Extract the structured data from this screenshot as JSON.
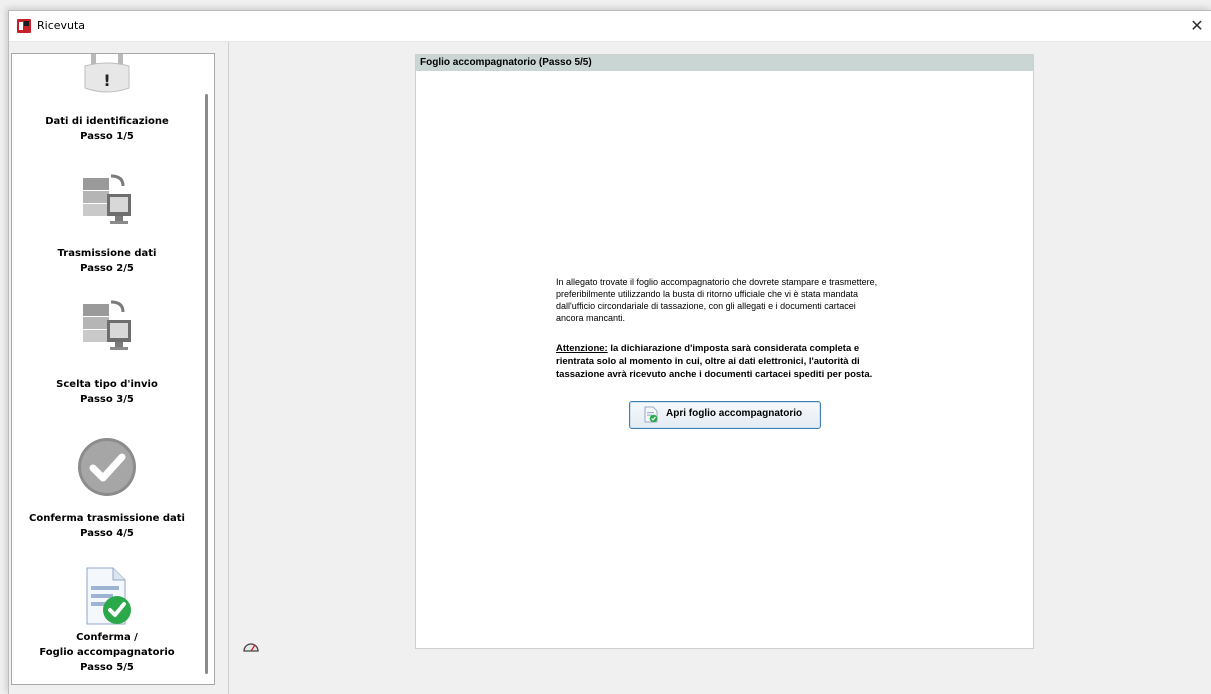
{
  "window": {
    "title": "Ricevuta",
    "close_glyph": "✕"
  },
  "steps": [
    {
      "icon": "lock-warning-icon",
      "name": "Dati di identificazione",
      "step": "Passo 1/5"
    },
    {
      "icon": "server-transfer-icon",
      "name": "Trasmissione dati",
      "step": "Passo 2/5"
    },
    {
      "icon": "server-transfer-icon",
      "name": "Scelta tipo d'invio",
      "step": "Passo 3/5"
    },
    {
      "icon": "checkmark-circle-icon",
      "name": "Conferma trasmissione dati",
      "step": "Passo 4/5"
    },
    {
      "icon": "document-check-icon",
      "name": "Conferma /",
      "name2": "Foglio accompagnatorio",
      "step": "Passo 5/5"
    }
  ],
  "panel": {
    "header": "Foglio accompagnatorio (Passo 5/5)",
    "body_lines": [
      "In allegato trovate il foglio accompagnatorio che dovrete stampare e trasmettere,",
      "preferibilmente utilizzando la busta di ritorno ufficiale che vi è stata mandata",
      "dall'ufficio circondariale di tassazione, con gli allegati e i documenti cartacei",
      "ancora mancanti."
    ],
    "warning_label": "Attenzione:",
    "warning_lines": [
      " la dichiarazione d'imposta sarà considerata completa e",
      "rientrata solo al momento in cui, oltre ai dati elettronici, l'autorità di",
      "tassazione avrà ricevuto anche i documenti cartacei spediti per posta."
    ],
    "button_label": "Apri foglio accompagnatorio"
  },
  "colors": {
    "header_bg": "#c9d6d3",
    "button_border": "#3c7fb1",
    "check_green": "#2aa84a"
  }
}
